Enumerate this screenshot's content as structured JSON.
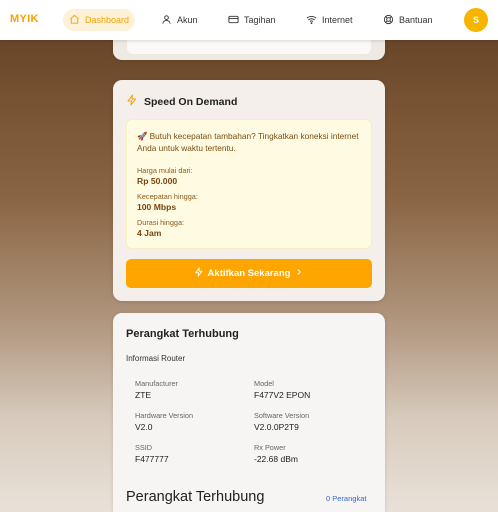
{
  "nav": {
    "logo": "MYIK",
    "items": [
      {
        "label": "Dashboard",
        "icon": "home-icon",
        "active": true
      },
      {
        "label": "Akun",
        "icon": "user-icon",
        "active": false
      },
      {
        "label": "Tagihan",
        "icon": "credit-card-icon",
        "active": false
      },
      {
        "label": "Internet",
        "icon": "wifi-icon",
        "active": false
      },
      {
        "label": "Bantuan",
        "icon": "lifebuoy-icon",
        "active": false
      }
    ],
    "avatar_initial": "S"
  },
  "speed": {
    "title": "Speed On Demand",
    "promo_text": "🚀 Butuh kecepatan tambahan? Tingkatkan koneksi internet Anda untuk waktu tertentu.",
    "price_label": "Harga mulai dari:",
    "price_value": "Rp 50.000",
    "speed_label": "Kecepatan hingga:",
    "speed_value": "100 Mbps",
    "duration_label": "Durasi hingga:",
    "duration_value": "4 Jam",
    "button_label": "Aktifkan Sekarang"
  },
  "devices": {
    "title": "Perangkat Terhubung",
    "router_info_label": "Informasi Router",
    "manufacturer_label": "Manufacturer",
    "manufacturer_value": "ZTE",
    "model_label": "Model",
    "model_value": "F477V2 EPON",
    "hw_label": "Hardware Version",
    "hw_value": "V2.0",
    "sw_label": "Software Version",
    "sw_value": "V2.0.0P2T9",
    "ssid_label": "SSID",
    "ssid_value": "F477777",
    "rx_label": "Rx Power",
    "rx_value": "-22.68 dBm",
    "list_title": "Perangkat Terhubung",
    "count": "0 Perangkat"
  },
  "colors": {
    "accent": "#ffa500",
    "link": "#3a66d8"
  }
}
